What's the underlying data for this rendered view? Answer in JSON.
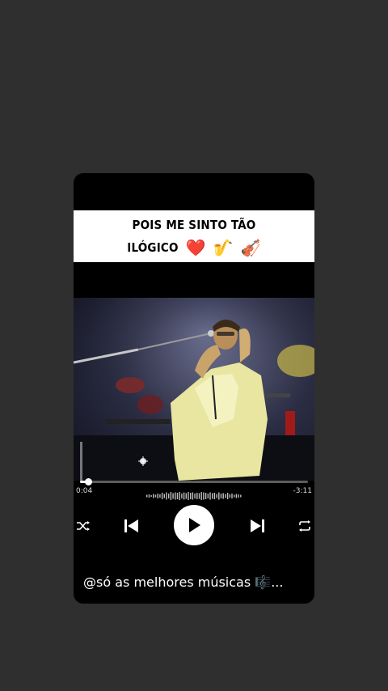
{
  "caption": {
    "line1": "POIS ME SINTO TÃO",
    "line2": "ILÓGICO",
    "emojis": [
      "❤️",
      "🎷",
      "🎻"
    ]
  },
  "player": {
    "elapsed": "0:04",
    "remaining": "-3:11",
    "progress_fraction": 0.035,
    "controls": [
      "shuffle-icon",
      "previous-icon",
      "play-icon",
      "next-icon",
      "repeat-icon"
    ]
  },
  "footer": {
    "text": "@só as melhores músicas 🎼..."
  },
  "colors": {
    "background": "#2f2f2f",
    "card": "#000000",
    "caption_bg": "#ffffff",
    "jacket": "#e8e6a0"
  }
}
